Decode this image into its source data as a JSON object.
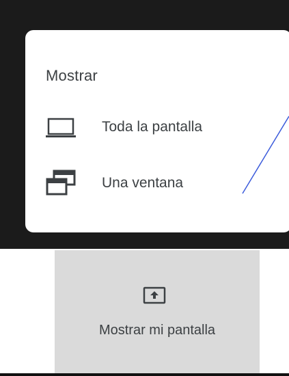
{
  "menu": {
    "title": "Mostrar",
    "items": [
      {
        "label": "Toda la pantalla",
        "icon": "laptop-icon"
      },
      {
        "label": "Una ventana",
        "icon": "window-icon"
      }
    ]
  },
  "present_button": {
    "label": "Mostrar mi pantalla",
    "icon": "present-screen-icon"
  },
  "colors": {
    "background_dark": "#1b1b1b",
    "card": "#ffffff",
    "text": "#3c4043",
    "annotation_line": "#3b5bdb",
    "present_panel": "#dadada"
  }
}
